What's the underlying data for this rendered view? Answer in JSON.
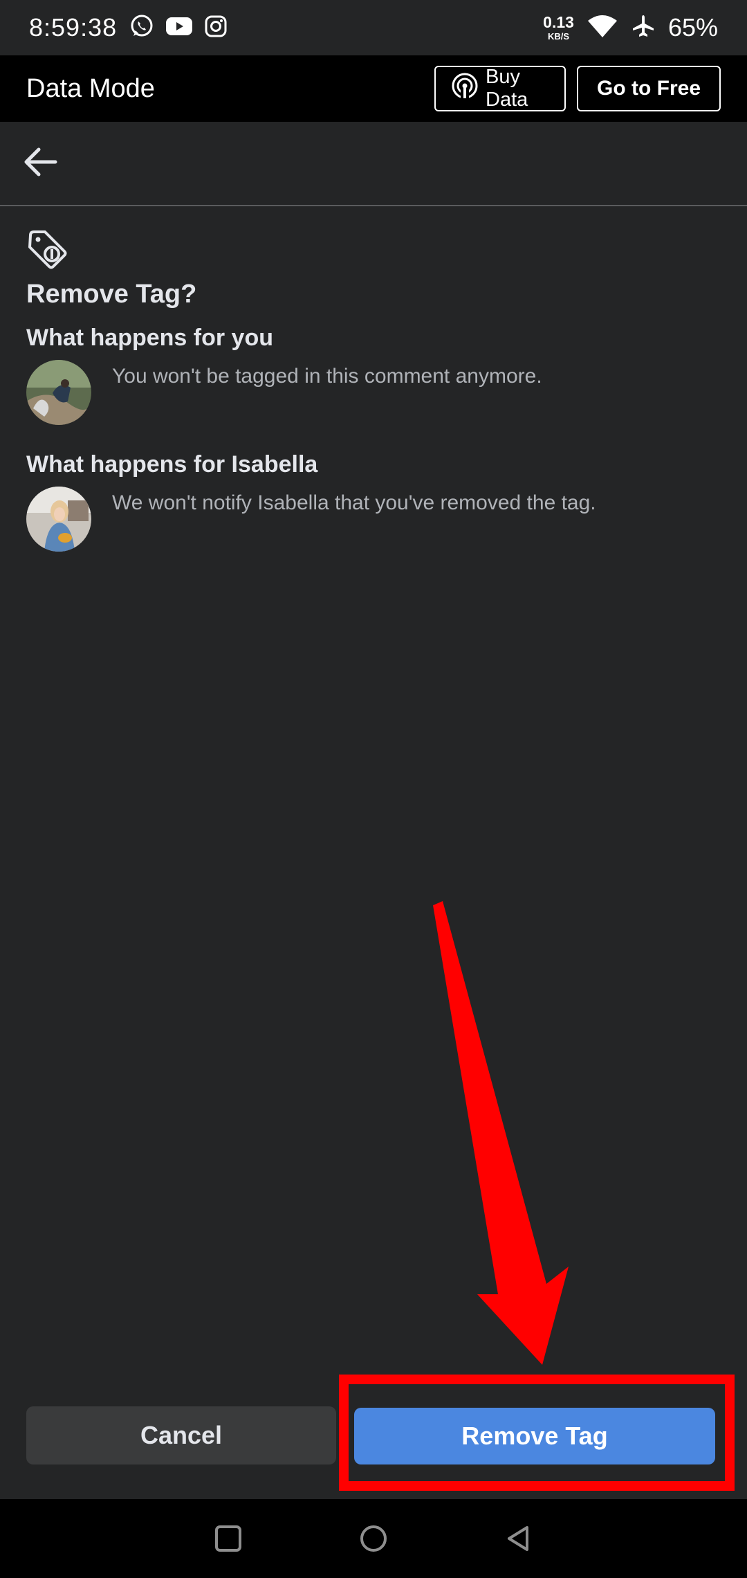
{
  "status_bar": {
    "time": "8:59:38",
    "net_speed_value": "0.13",
    "net_speed_unit": "KB/S",
    "battery": "65%",
    "app_icons": [
      "whatsapp-icon",
      "youtube-icon",
      "instagram-icon"
    ],
    "system_icons": [
      "wifi-icon",
      "airplane-icon"
    ]
  },
  "data_mode": {
    "title": "Data Mode",
    "buy_data_label": "Buy Data",
    "go_free_label": "Go to Free"
  },
  "header": {
    "back_icon": "back-arrow-icon"
  },
  "content": {
    "icon": "tag-icon",
    "title": "Remove Tag?",
    "sections": [
      {
        "heading": "What happens for you",
        "text": "You won't be tagged in this comment anymore."
      },
      {
        "heading": "What happens for Isabella",
        "text": "We won't notify Isabella that you've removed the tag."
      }
    ]
  },
  "actions": {
    "cancel_label": "Cancel",
    "remove_label": "Remove Tag"
  },
  "colors": {
    "background": "#242526",
    "primary_button": "#4b87e0",
    "secondary_button": "#3a3b3c",
    "annotation": "#ff0000"
  },
  "nav_bar": {
    "icons": [
      "recents-square-icon",
      "home-circle-icon",
      "back-triangle-icon"
    ]
  }
}
